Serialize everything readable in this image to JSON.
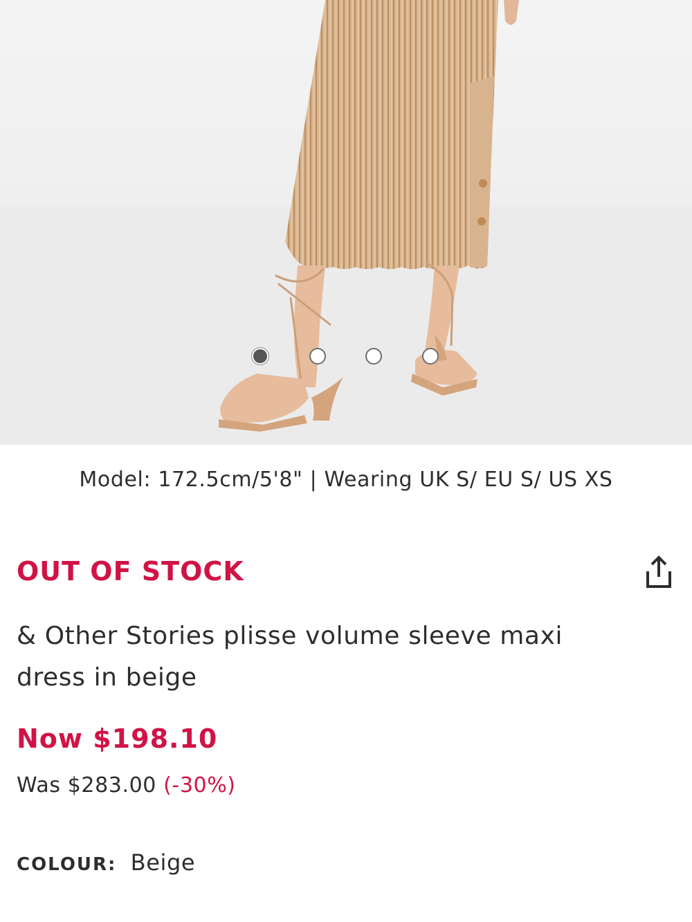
{
  "product": {
    "image_alt": "dress-photo",
    "carousel": {
      "count": 4,
      "active_index": 0
    },
    "model_info": "Model: 172.5cm/5'8\" | Wearing UK S/ EU S/ US XS",
    "stock_status": "OUT OF STOCK",
    "share_icon": "share-icon",
    "title": "& Other Stories plisse volume sleeve maxi dress in beige",
    "price": {
      "now": "Now $198.10",
      "was_label": "Was $283.00",
      "discount": "(-30%)"
    },
    "colour": {
      "label": "COLOUR:",
      "value": "Beige"
    }
  },
  "colors": {
    "sale_red": "#d01345",
    "text": "#2d2d2d",
    "dress_beige": "#d9b48c"
  }
}
